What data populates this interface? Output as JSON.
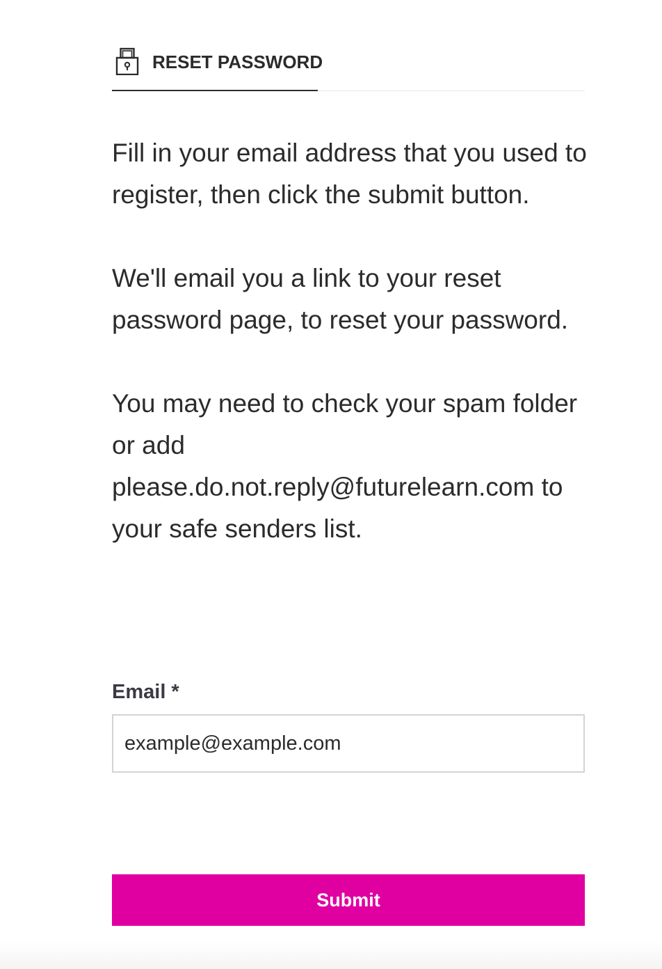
{
  "tab": {
    "icon": "lock-icon",
    "label": "RESET PASSWORD"
  },
  "instructions": {
    "p1": "Fill in your email address that you used to register, then click the submit button.",
    "p2": "We'll email you a link to your reset password page, to reset your password.",
    "p3": "You may need to check your spam folder or add please.do.not.reply@futurelearn.com to your safe senders list."
  },
  "form": {
    "email_label": "Email *",
    "email_placeholder": "example@example.com",
    "email_value": ""
  },
  "actions": {
    "submit_label": "Submit"
  },
  "colors": {
    "accent": "#e000a2",
    "text": "#2b2b2b"
  }
}
